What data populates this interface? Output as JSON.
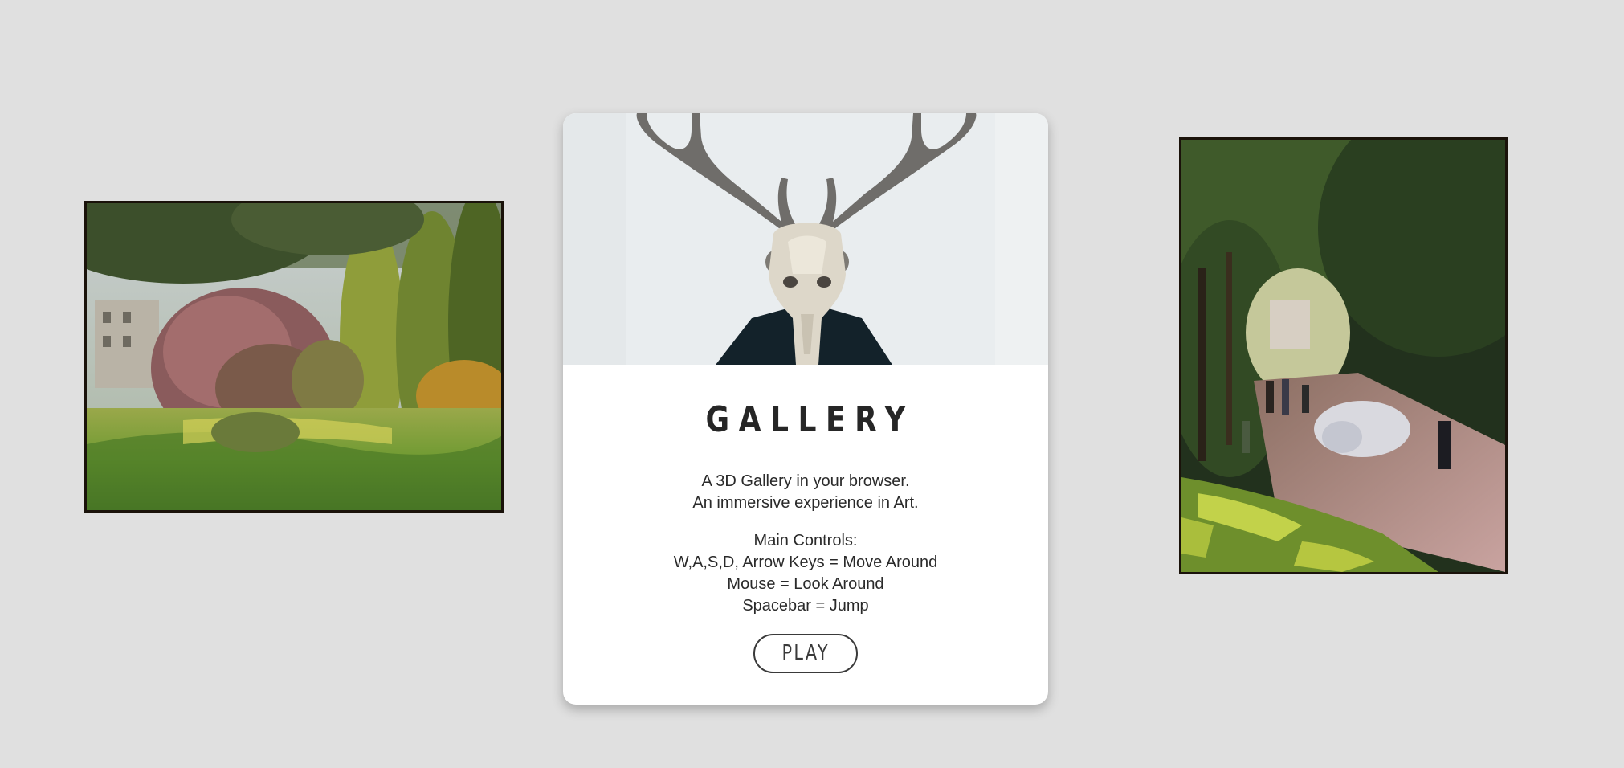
{
  "card": {
    "title": "GALLERY",
    "description": [
      "A 3D Gallery in your browser.",
      "An immersive experience in Art."
    ],
    "controls": [
      "Main Controls:",
      "W,A,S,D, Arrow Keys = Move Around",
      "Mouse = Look Around",
      "Spacebar = Jump"
    ],
    "play_label": "PLAY"
  },
  "colors": {
    "background": "#e0e0e0",
    "card": "#ffffff",
    "text": "#2a2a2a"
  }
}
